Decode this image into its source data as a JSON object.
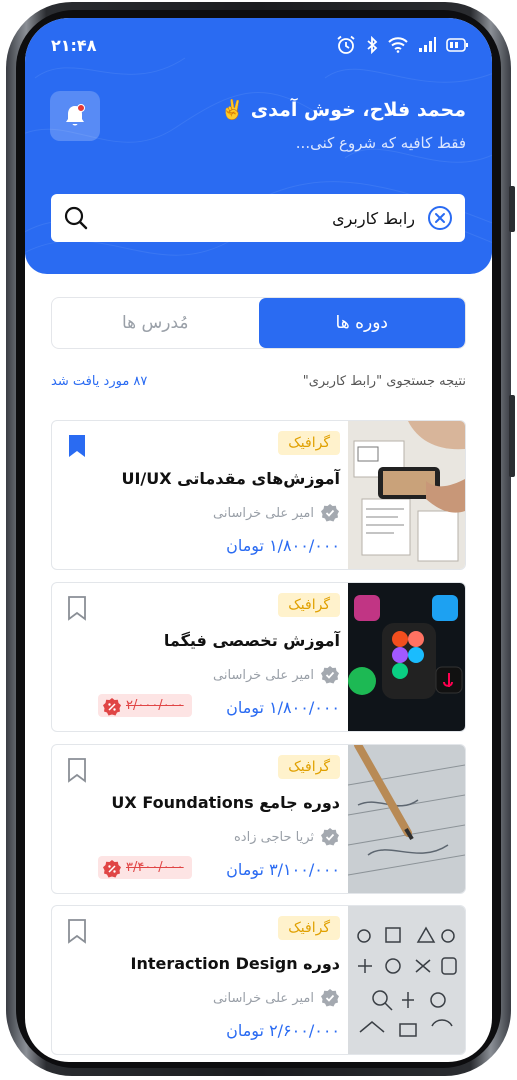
{
  "status_bar": {
    "time": "۲۱:۴۸"
  },
  "header": {
    "greeting": "محمد فلاح، خوش آمدی ✌️",
    "subtitle": "فقط کافیه که شروع کنی..."
  },
  "search": {
    "value": "رابط کاربری"
  },
  "tabs": [
    {
      "label": "دوره ها",
      "active": true
    },
    {
      "label": "مُدرس ها",
      "active": false
    }
  ],
  "results": {
    "query_text": "نتیجه جستجوی \"رابط کاربری\"",
    "count_text": "۸۷ مورد یافت شد"
  },
  "courses": [
    {
      "category": "گرافیک",
      "title": "آموزش‌های مقدماتی UI/UX",
      "teacher": "امیر علی خراسانی",
      "price": "۱/۸۰۰/۰۰۰ تومان",
      "old_price": "",
      "bookmarked": true,
      "thumb": "sketch"
    },
    {
      "category": "گرافیک",
      "title": "آموزش تخصصی فیگما",
      "teacher": "امیر علی خراسانی",
      "price": "۱/۸۰۰/۰۰۰ تومان",
      "old_price": "۲/۰۰۰/۰۰۰",
      "bookmarked": false,
      "thumb": "apps"
    },
    {
      "category": "گرافیک",
      "title": "دوره جامع UX Foundations",
      "teacher": "ثریا حاجی زاده",
      "price": "۳/۱۰۰/۰۰۰ تومان",
      "old_price": "۳/۴۰۰/۰۰۰",
      "bookmarked": false,
      "thumb": "pencil"
    },
    {
      "category": "گرافیک",
      "title": "دوره Interaction Design",
      "teacher": "امیر علی خراسانی",
      "price": "۲/۶۰۰/۰۰۰ تومان",
      "old_price": "",
      "bookmarked": false,
      "thumb": "icons"
    }
  ],
  "colors": {
    "primary": "#2a6bf2",
    "tag_bg": "#fff2cc",
    "tag_text": "#e0a000",
    "discount_bg": "#fde4e4",
    "discount_text": "#e04545"
  }
}
